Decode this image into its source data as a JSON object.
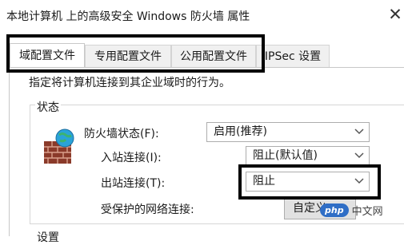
{
  "window": {
    "title": "本地计算机 上的高级安全 Windows 防火墙 属性",
    "close_glyph": "✕"
  },
  "tabs": [
    {
      "label": "域配置文件",
      "active": true
    },
    {
      "label": "专用配置文件",
      "active": false
    },
    {
      "label": "公用配置文件",
      "active": false
    },
    {
      "label": "IPSec 设置",
      "active": false
    }
  ],
  "profile": {
    "description": "指定将计算机连接到其企业域时的行为。",
    "state_group": "状态",
    "firewall_state_label": "防火墙状态(F):",
    "firewall_state_value": "启用(推荐)",
    "inbound_label": "入站连接(I):",
    "inbound_value": "阻止(默认值)",
    "outbound_label": "出站连接(T):",
    "outbound_value": "阻止",
    "protected_label": "受保护的网络连接:",
    "customize_button": "自定义",
    "settings_group": "设置"
  },
  "watermark": {
    "badge": "php",
    "text": "中文网"
  },
  "icons": {
    "firewall": "firewall-shield-icon",
    "dropdown": "chevron-down-icon",
    "close": "close-icon"
  },
  "colors": {
    "highlight_box": "#000000",
    "watermark_badge": "#2f6ec6"
  }
}
